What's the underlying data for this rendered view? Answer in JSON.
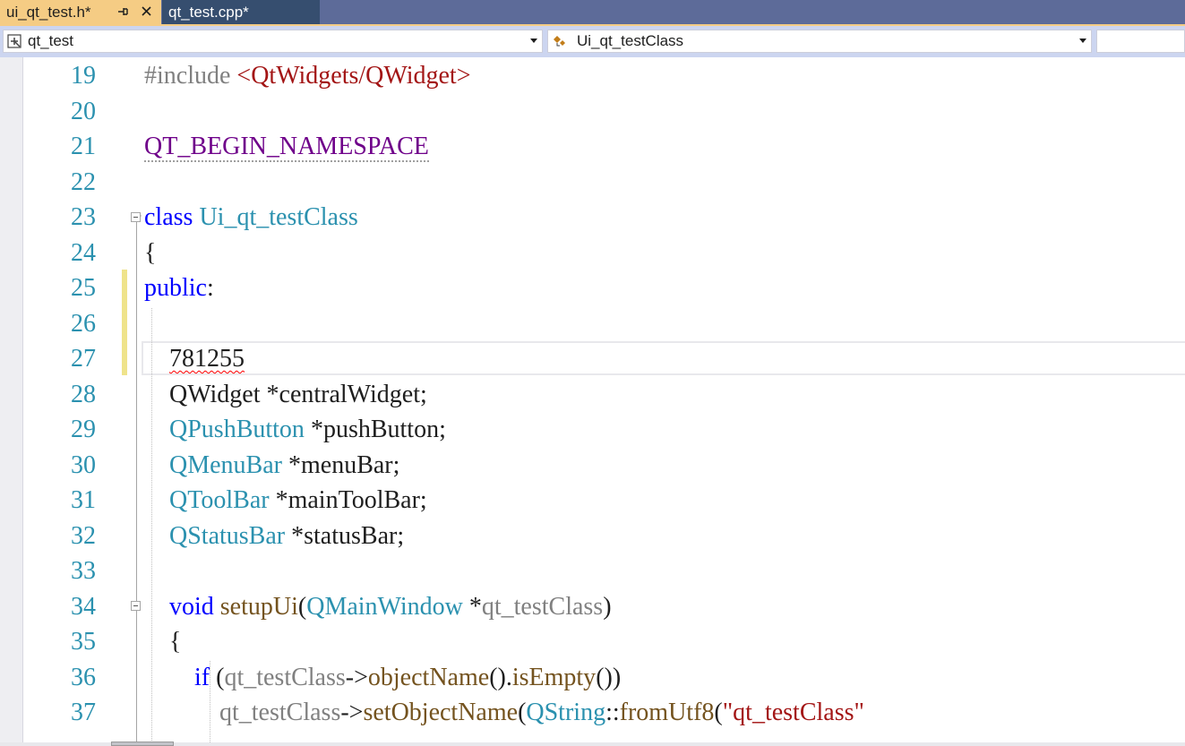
{
  "tabs": [
    {
      "label": "ui_qt_test.h*",
      "active": true
    },
    {
      "label": "qt_test.cpp*",
      "active": false
    }
  ],
  "nav": {
    "project": "qt_test",
    "scope": "Ui_qt_testClass",
    "extra": ""
  },
  "editor": {
    "line_numbers": [
      "19",
      "20",
      "21",
      "22",
      "23",
      "24",
      "25",
      "26",
      "27",
      "28",
      "29",
      "30",
      "31",
      "32",
      "33",
      "34",
      "35",
      "36",
      "37"
    ],
    "lines": [
      [
        {
          "t": "#include ",
          "c": "pp"
        },
        {
          "t": "<QtWidgets/QWidget>",
          "c": "inc"
        }
      ],
      [],
      [
        {
          "t": "QT_BEGIN_NAMESPACE",
          "c": "mac"
        }
      ],
      [],
      [
        {
          "t": "class ",
          "c": "kw"
        },
        {
          "t": "Ui_qt_testClass",
          "c": "typ"
        }
      ],
      [
        {
          "t": "{",
          "c": "txt"
        }
      ],
      [
        {
          "t": "public",
          "c": "kw"
        },
        {
          "t": ":",
          "c": "txt"
        }
      ],
      [],
      [
        {
          "t": "    ",
          "c": "txt"
        },
        {
          "t": "781255",
          "c": "txt",
          "squiggle": true
        }
      ],
      [
        {
          "t": "    QWidget *centralWidget;",
          "c": "txt"
        }
      ],
      [
        {
          "t": "    ",
          "c": "txt"
        },
        {
          "t": "QPushButton",
          "c": "typ"
        },
        {
          "t": " *pushButton;",
          "c": "txt"
        }
      ],
      [
        {
          "t": "    ",
          "c": "txt"
        },
        {
          "t": "QMenuBar",
          "c": "typ"
        },
        {
          "t": " *menuBar;",
          "c": "txt"
        }
      ],
      [
        {
          "t": "    ",
          "c": "txt"
        },
        {
          "t": "QToolBar",
          "c": "typ"
        },
        {
          "t": " *mainToolBar;",
          "c": "txt"
        }
      ],
      [
        {
          "t": "    ",
          "c": "txt"
        },
        {
          "t": "QStatusBar",
          "c": "typ"
        },
        {
          "t": " *statusBar;",
          "c": "txt"
        }
      ],
      [],
      [
        {
          "t": "    ",
          "c": "txt"
        },
        {
          "t": "void ",
          "c": "kw"
        },
        {
          "t": "setupUi",
          "c": "fn"
        },
        {
          "t": "(",
          "c": "txt"
        },
        {
          "t": "QMainWindow",
          "c": "typ"
        },
        {
          "t": " *",
          "c": "txt"
        },
        {
          "t": "qt_testClass",
          "c": "par"
        },
        {
          "t": ")",
          "c": "txt"
        }
      ],
      [
        {
          "t": "    {",
          "c": "txt"
        }
      ],
      [
        {
          "t": "        ",
          "c": "txt"
        },
        {
          "t": "if ",
          "c": "kw"
        },
        {
          "t": "(",
          "c": "txt"
        },
        {
          "t": "qt_testClass",
          "c": "par"
        },
        {
          "t": "->",
          "c": "txt"
        },
        {
          "t": "objectName",
          "c": "fn"
        },
        {
          "t": "().",
          "c": "txt"
        },
        {
          "t": "isEmpty",
          "c": "fn"
        },
        {
          "t": "())",
          "c": "txt"
        }
      ],
      [
        {
          "t": "            ",
          "c": "txt"
        },
        {
          "t": "qt_testClass",
          "c": "par"
        },
        {
          "t": "->",
          "c": "txt"
        },
        {
          "t": "setObjectName",
          "c": "fn"
        },
        {
          "t": "(",
          "c": "txt"
        },
        {
          "t": "QString",
          "c": "typ"
        },
        {
          "t": "::",
          "c": "txt"
        },
        {
          "t": "fromUtf8",
          "c": "fn"
        },
        {
          "t": "(",
          "c": "txt"
        },
        {
          "t": "\"qt_testClass\"",
          "c": "str"
        }
      ]
    ]
  },
  "colors": {
    "tab_strip": "#5d6b99",
    "active_tab": "#f5cc84",
    "inactive_tab": "#364e6f",
    "nav_bar": "#ccd5f0",
    "line_number": "#2b91af",
    "keyword": "#0000ff",
    "type": "#2b91af",
    "macro": "#6f008a",
    "string": "#a31515",
    "change_marker": "#efe38b"
  },
  "icons": {
    "tab_pin": "pin-icon",
    "tab_close": "close-icon",
    "project_combo": "project-icon",
    "scope_combo": "class-icon"
  }
}
